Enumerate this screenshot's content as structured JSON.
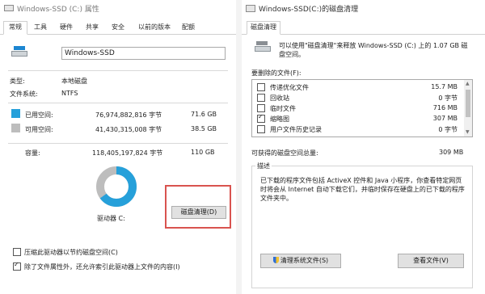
{
  "left_window": {
    "title": "Windows-SSD (C:) 属性",
    "tabs": [
      "常规",
      "工具",
      "硬件",
      "共享",
      "安全",
      "以前的版本",
      "配额"
    ],
    "active_tab": "常规",
    "drive_name_value": "Windows-SSD",
    "type_label": "类型:",
    "type_value": "本地磁盘",
    "fs_label": "文件系统:",
    "fs_value": "NTFS",
    "used": {
      "label": "已用空间:",
      "bytes": "76,974,882,816 字节",
      "size": "71.6 GB",
      "color": "#26a0da"
    },
    "free": {
      "label": "可用空间:",
      "bytes": "41,430,315,008 字节",
      "size": "38.5 GB",
      "color": "#bdbdbd"
    },
    "capacity": {
      "label": "容量:",
      "bytes": "118,405,197,824 字节",
      "size": "110 GB"
    },
    "used_fraction": 0.65,
    "drive_label": "驱动器 C:",
    "cleanup_button": "磁盘清理(D)",
    "highlight_color": "#d9534f",
    "compress_label": "压缩此驱动器以节约磁盘空间(C)",
    "compress_checked": false,
    "index_label": "除了文件属性外，还允许索引此驱动器上文件的内容(I)",
    "index_checked": true
  },
  "right_window": {
    "title": "Windows-SSD(C:)的磁盘清理",
    "tab": "磁盘清理",
    "intro": "可以使用\"磁盘清理\"来释放 Windows-SSD (C:) 上的 1.07 GB 磁盘空间。",
    "files_label": "要删除的文件(F):",
    "files": [
      {
        "name": "传递优化文件",
        "size": "15.7 MB",
        "checked": false
      },
      {
        "name": "回收站",
        "size": "0 字节",
        "checked": false
      },
      {
        "name": "临时文件",
        "size": "716 MB",
        "checked": false
      },
      {
        "name": "缩略图",
        "size": "307 MB",
        "checked": true
      },
      {
        "name": "用户文件历史记录",
        "size": "0 字节",
        "checked": false
      }
    ],
    "gain_label": "可获得的磁盘空间总量:",
    "gain_value": "309 MB",
    "desc_title": "描述",
    "desc_text": "已下载的程序文件包括 ActiveX 控件和 Java 小程序，你查看特定网页时将会从 Internet 自动下载它们，并临时保存在硬盘上的已下载的程序文件夹中。",
    "clean_system_button": "清理系统文件(S)",
    "view_files_button": "查看文件(V)"
  }
}
